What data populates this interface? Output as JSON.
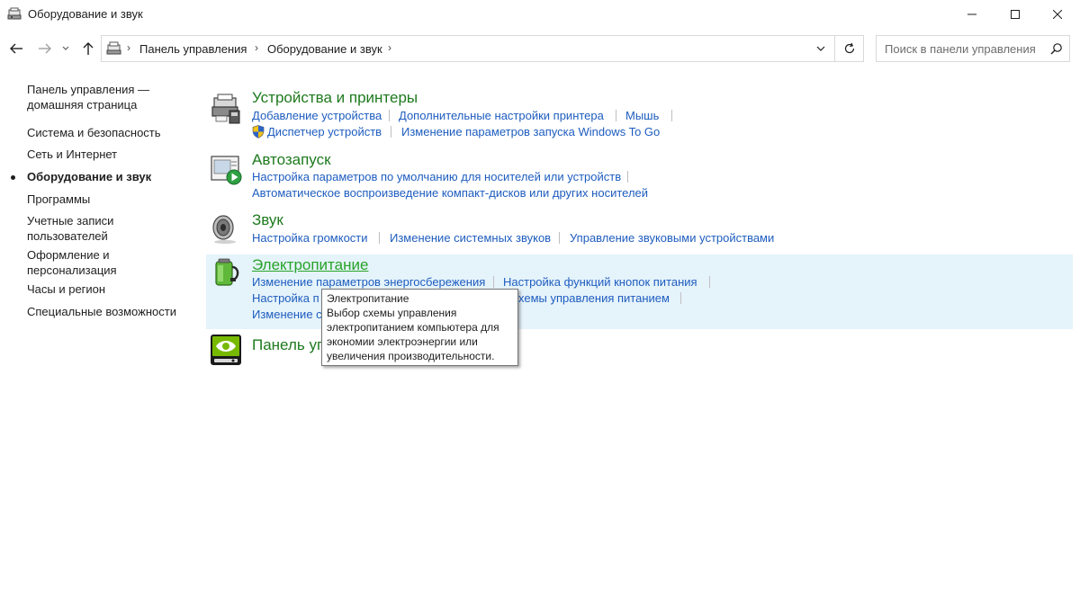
{
  "window": {
    "title": "Оборудование и звук",
    "title_icon": "devices-and-sound-icon"
  },
  "nav": {
    "back": "back-arrow-icon",
    "forward": "forward-arrow-icon",
    "recent": "chevron-down-icon",
    "up": "up-arrow-icon"
  },
  "breadcrumb": {
    "items": [
      "Панель управления",
      "Оборудование и звук"
    ]
  },
  "search": {
    "placeholder": "Поиск в панели управления",
    "value": ""
  },
  "sidebar": {
    "items": [
      {
        "label_lines": [
          "Панель управления —",
          "домашняя страница"
        ],
        "active": false
      },
      {
        "label_lines": [
          "Система и безопасность"
        ],
        "active": false
      },
      {
        "label_lines": [
          "Сеть и Интернет"
        ],
        "active": false
      },
      {
        "label_lines": [
          "Оборудование и звук"
        ],
        "active": true
      },
      {
        "label_lines": [
          "Программы"
        ],
        "active": false
      },
      {
        "label_lines": [
          "Учетные записи",
          "пользователей"
        ],
        "active": false
      },
      {
        "label_lines": [
          "Оформление и",
          "персонализация"
        ],
        "active": false
      },
      {
        "label_lines": [
          "Часы и регион"
        ],
        "active": false
      },
      {
        "label_lines": [
          "Специальные возможности"
        ],
        "active": false
      }
    ]
  },
  "categories": [
    {
      "title": "Устройства и принтеры",
      "icon": "devices-printers-icon",
      "links": [
        [
          "Добавление устройства",
          "Дополнительные настройки принтера",
          "Мышь"
        ],
        [
          "Диспетчер устройств",
          "Изменение параметров запуска Windows To Go"
        ]
      ]
    },
    {
      "title": "Автозапуск",
      "icon": "autoplay-icon",
      "links": [
        [
          "Настройка параметров по умолчанию для носителей или устройств"
        ],
        [
          "Автоматическое воспроизведение компакт-дисков или других носителей"
        ]
      ]
    },
    {
      "title": "Звук",
      "icon": "speaker-icon",
      "links": [
        [
          "Настройка громкости",
          "Изменение системных звуков",
          "Управление звуковыми устройствами"
        ]
      ]
    },
    {
      "title": "Электропитание",
      "icon": "power-options-icon",
      "links": [
        [
          "Изменение параметров энергосбережения",
          "Настройка функций кнопок питания"
        ],
        [
          "Настройка п",
          "хемы управления питанием"
        ],
        [
          "Изменение с"
        ]
      ]
    },
    {
      "title": "Панель уп",
      "icon": "nvidia-icon",
      "links": []
    }
  ],
  "tooltip": {
    "lines": [
      "Электропитание",
      "Выбор схемы управления",
      "электропитанием компьютера для",
      "экономии электроэнергии или",
      "увеличения производительности."
    ]
  }
}
